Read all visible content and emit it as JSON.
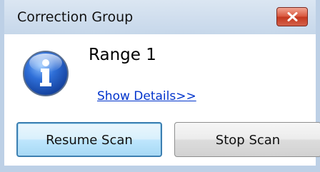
{
  "window": {
    "title": "Correction Group"
  },
  "icons": {
    "message_icon": "info-icon",
    "close_icon": "close-icon"
  },
  "message": {
    "text": "Range 1",
    "details_link": "Show Details>>"
  },
  "buttons": {
    "resume_label": "Resume Scan",
    "stop_label": "Stop Scan"
  },
  "colors": {
    "close_button": "#d9573e",
    "link": "#0033cc",
    "focused_button_border": "#3c7fb1",
    "frame": "#bdd0e6"
  }
}
